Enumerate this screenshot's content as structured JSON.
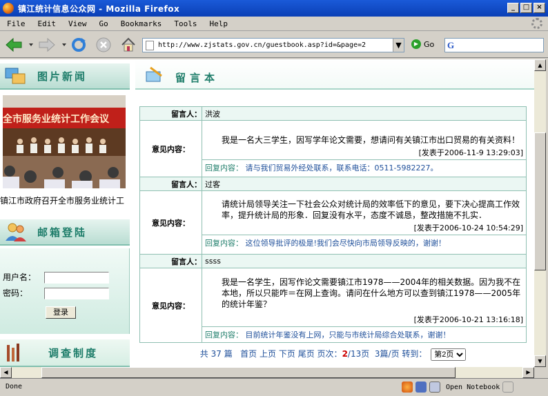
{
  "window": {
    "title": "镇江统计信息公众网 - Mozilla Firefox",
    "buttons": [
      "_",
      "□",
      "×"
    ]
  },
  "menu": [
    "File",
    "Edit",
    "View",
    "Go",
    "Bookmarks",
    "Tools",
    "Help"
  ],
  "toolbar": {
    "url": "http://www.zjstats.gov.cn/guestbook.asp?id=&page=2",
    "go_label": "Go",
    "search_placeholder": ""
  },
  "left": {
    "photo_news_title": "图片新闻",
    "photo_banner": "全市服务业统计工作会议",
    "photo_caption": "镇江市政府召开全市服务业统计工",
    "mail_login_title": "邮箱登陆",
    "username_label": "用户名：",
    "password_label": "密码：",
    "login_button": "登录",
    "survey_title": "调查制度"
  },
  "guestbook": {
    "title": "留言本",
    "name_label": "留言人：",
    "content_label": "意见内容：",
    "reply_label": "回复内容：",
    "entries": [
      {
        "name": "洪波",
        "content": "我是一名大三学生，因写学年论文需要，想请问有关镇江市出口贸易的有关资料！",
        "date": "[发表于2006-11-9 13:29:03]",
        "reply": "请与我们贸易外经处联系，联系电话：0511-5982227。"
      },
      {
        "name": "过客",
        "content": "请统计局领导关注一下社会公众对统计局的效率低下的意见，要下决心提高工作效率，提升统计局的形象．回复没有水平，态度不诚恳，整改措施不扎实．",
        "date": "[发表于2006-10-24 10:54:29]",
        "reply": "这位领导批评的极是!我们会尽快向市局领导反映的，谢谢！"
      },
      {
        "name": "ssss",
        "content": "我是一名学生，因写作论文需要镇江市1978——2004年的相关数据。因为我不在本地，所以只能咋＝在网上查询。请问在什么地方可以查到镇江1978——2005年的统计年鉴？",
        "date": "[发表于2006-10-21 13:16:18]",
        "reply": "目前统计年鉴没有上网，只能与市统计局综合处联系，谢谢！"
      }
    ]
  },
  "pager": {
    "total_prefix": "共",
    "total": "37",
    "total_suffix": "篇",
    "first": "首页",
    "prev": "上页",
    "next": "下页",
    "last": "尾页",
    "pageno_label": "页次：",
    "current": "2",
    "sep": "/",
    "pages": "13页",
    "per_page": "3篇/页",
    "goto": "转到：",
    "selected": "第2页"
  },
  "status": {
    "text": "Done",
    "notebook": "Open Notebook"
  }
}
